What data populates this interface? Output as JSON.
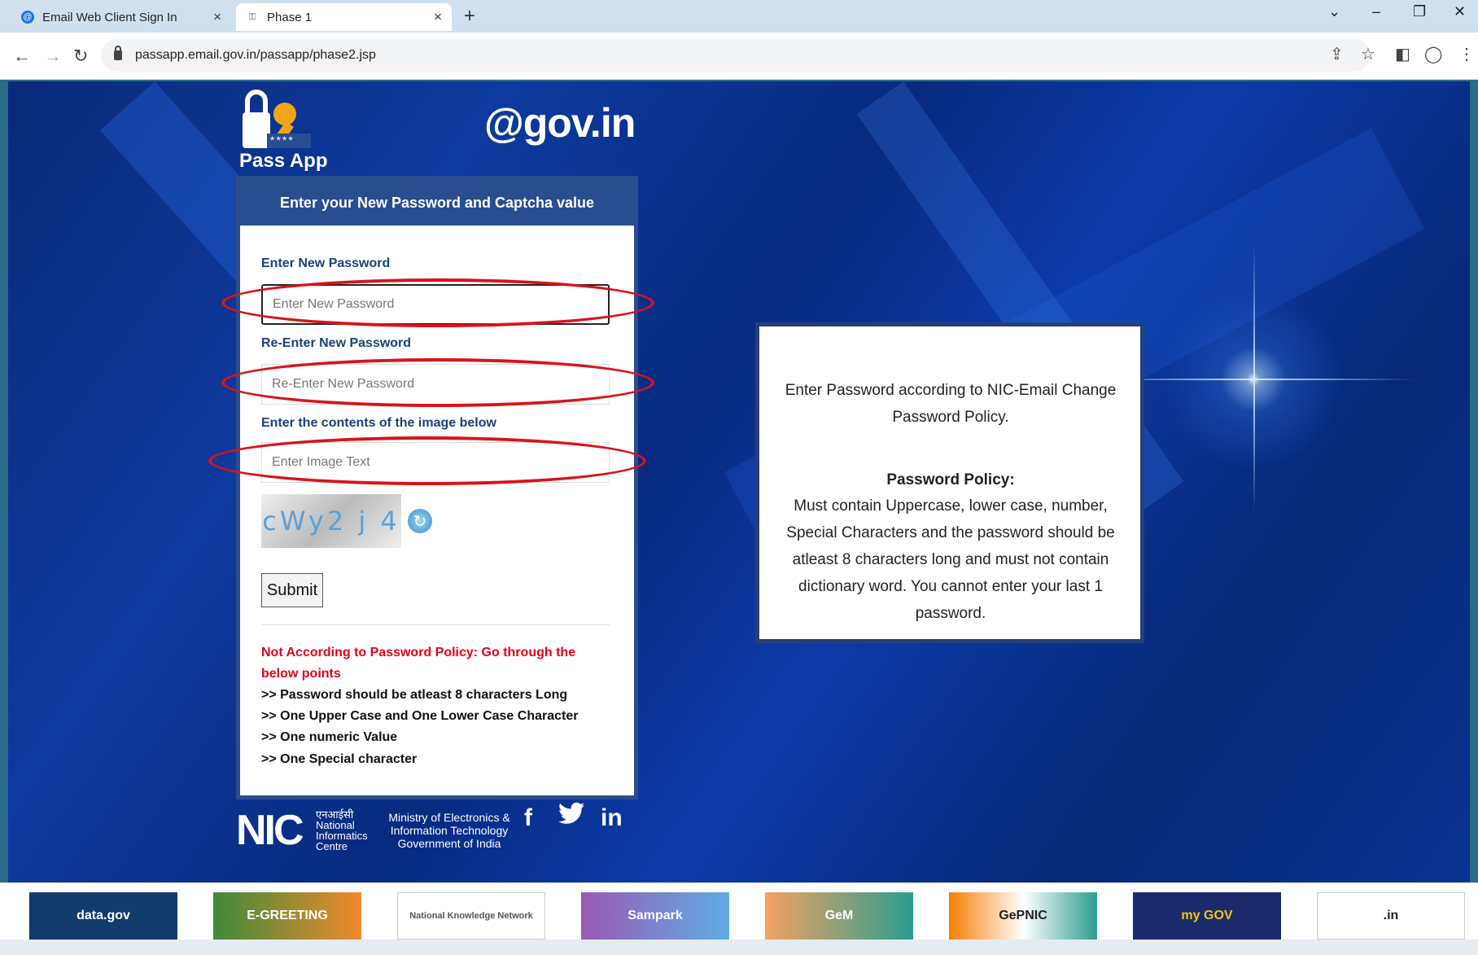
{
  "browser": {
    "tabs": [
      {
        "label": "Email Web Client Sign In",
        "icon": "globe-icon"
      },
      {
        "label": "Phase 1",
        "icon": "nic-favicon-icon"
      }
    ],
    "url": "passapp.email.gov.in/passapp/phase2.jsp"
  },
  "header": {
    "passapp_label": "Pass App",
    "gov_logo": "@gov.in",
    "password_mask": "****"
  },
  "form": {
    "title": "Enter your New Password and Captcha value",
    "new_password_label": "Enter New Password",
    "new_password_placeholder": "Enter New Password",
    "reenter_label": "Re-Enter New Password",
    "reenter_placeholder": "Re-Enter New Password",
    "captcha_label": "Enter the contents of the image below",
    "captcha_placeholder": "Enter Image Text",
    "captcha_text": "cWy2 j 4",
    "submit_label": "Submit",
    "warning": "Not According to Password Policy: Go through the below points",
    "points": [
      ">> Password should be atleast 8 characters Long",
      ">> One Upper Case and One Lower Case Character",
      ">> One numeric Value",
      ">> One Special character"
    ]
  },
  "policy": {
    "intro": "Enter Password according to NIC-Email Change Password Policy.",
    "heading": "Password Policy:",
    "body": "Must contain Uppercase, lower case, number, Special Characters and the password should be atleast 8 characters long and must not contain dictionary word. You cannot enter your last 1 password."
  },
  "footer": {
    "nic_mark": "NIC",
    "nic_hindi": "एनआईसी",
    "nic_text": "National Informatics Centre",
    "meity": "Ministry of Electronics & Information Technology Government of India",
    "social": [
      "f",
      "in"
    ]
  },
  "banners": [
    "data.gov",
    "E-GREETING",
    "National Knowledge Network",
    "Sampark",
    "GeM",
    "GePNIC",
    "my GOV",
    ".in"
  ],
  "colors": {
    "accent": "#2a4d8f",
    "warning": "#e3001b",
    "highlight": "#d8131b"
  }
}
